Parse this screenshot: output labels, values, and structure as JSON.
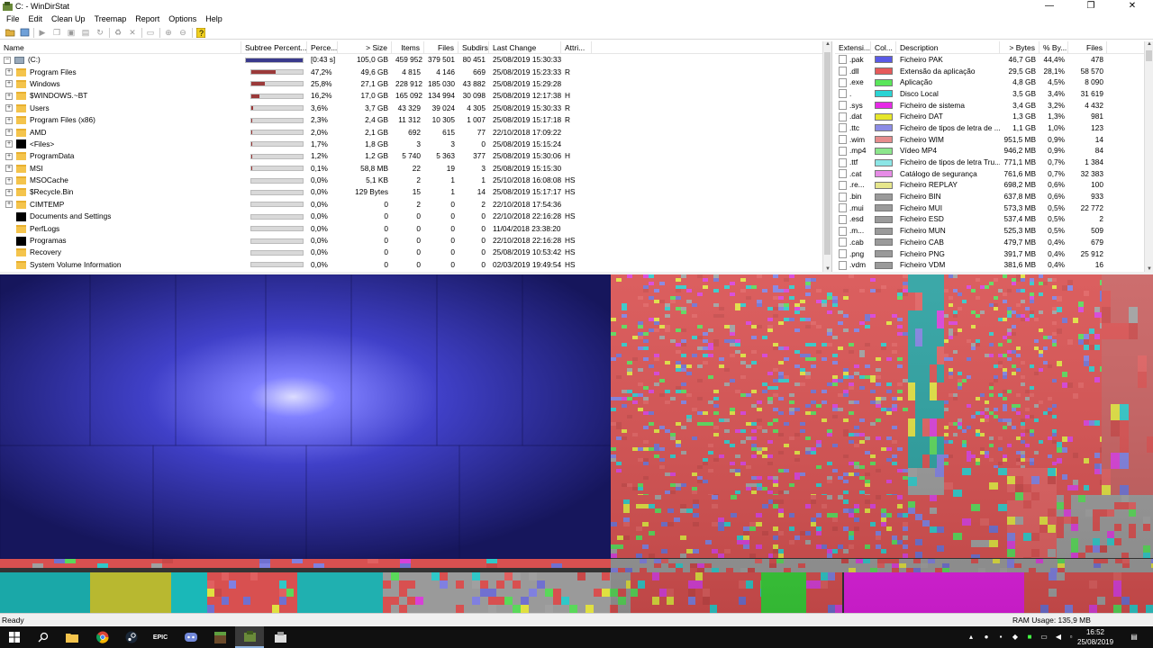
{
  "window": {
    "title": "C: - WinDirStat",
    "minimize": "—",
    "maximize": "❐",
    "close": "✕"
  },
  "menu": [
    "File",
    "Edit",
    "Clean Up",
    "Treemap",
    "Report",
    "Options",
    "Help"
  ],
  "toolbar": [
    "open-icon",
    "refresh-icon",
    "run-icon",
    "copy-path-icon",
    "explorer-icon",
    "command-prompt-icon",
    "refresh-selected-icon",
    "recycle-icon",
    "delete-icon",
    "new-folder-icon",
    "zoom-in-icon",
    "zoom-out-icon",
    "help-icon"
  ],
  "tree": {
    "headers": [
      "Name",
      "Subtree Percent...",
      "Perce...",
      "> Size",
      "Items",
      "Files",
      "Subdirs",
      "Last Change",
      "Attri..."
    ],
    "rows": [
      {
        "name": "(C:)",
        "icon": "drive",
        "expander": "-",
        "bar": 100,
        "top": true,
        "pct": "[0:43 s]",
        "size": "105,0 GB",
        "items": "459 952",
        "files": "379 501",
        "subdirs": "80 451",
        "change": "25/08/2019 15:30:33",
        "attr": ""
      },
      {
        "name": "Program Files",
        "icon": "folder",
        "expander": "+",
        "bar": 47.2,
        "pct": "47,2%",
        "size": "49,6 GB",
        "items": "4 815",
        "files": "4 146",
        "subdirs": "669",
        "change": "25/08/2019 15:23:33",
        "attr": "R"
      },
      {
        "name": "Windows",
        "icon": "folder",
        "expander": "+",
        "bar": 25.8,
        "pct": "25,8%",
        "size": "27,1 GB",
        "items": "228 912",
        "files": "185 030",
        "subdirs": "43 882",
        "change": "25/08/2019 15:29:28",
        "attr": ""
      },
      {
        "name": "$WINDOWS.~BT",
        "icon": "folder",
        "expander": "+",
        "bar": 16.2,
        "pct": "16,2%",
        "size": "17,0 GB",
        "items": "165 092",
        "files": "134 994",
        "subdirs": "30 098",
        "change": "25/08/2019 12:17:38",
        "attr": "H"
      },
      {
        "name": "Users",
        "icon": "folder",
        "expander": "+",
        "bar": 3.6,
        "pct": "3,6%",
        "size": "3,7 GB",
        "items": "43 329",
        "files": "39 024",
        "subdirs": "4 305",
        "change": "25/08/2019 15:30:33",
        "attr": "R"
      },
      {
        "name": "Program Files (x86)",
        "icon": "folder",
        "expander": "+",
        "bar": 2.3,
        "pct": "2,3%",
        "size": "2,4 GB",
        "items": "11 312",
        "files": "10 305",
        "subdirs": "1 007",
        "change": "25/08/2019 15:17:18",
        "attr": "R"
      },
      {
        "name": "AMD",
        "icon": "folder",
        "expander": "+",
        "bar": 2.0,
        "pct": "2,0%",
        "size": "2,1 GB",
        "items": "692",
        "files": "615",
        "subdirs": "77",
        "change": "22/10/2018 17:09:22",
        "attr": ""
      },
      {
        "name": "<Files>",
        "icon": "black",
        "expander": "+",
        "bar": 1.7,
        "pct": "1,7%",
        "size": "1,8 GB",
        "items": "3",
        "files": "3",
        "subdirs": "0",
        "change": "25/08/2019 15:15:24",
        "attr": ""
      },
      {
        "name": "ProgramData",
        "icon": "folder",
        "expander": "+",
        "bar": 1.2,
        "pct": "1,2%",
        "size": "1,2 GB",
        "items": "5 740",
        "files": "5 363",
        "subdirs": "377",
        "change": "25/08/2019 15:30:06",
        "attr": "H"
      },
      {
        "name": "MSI",
        "icon": "folder",
        "expander": "+",
        "bar": 0.1,
        "pct": "0,1%",
        "size": "58,8 MB",
        "items": "22",
        "files": "19",
        "subdirs": "3",
        "change": "25/08/2019 15:15:30",
        "attr": ""
      },
      {
        "name": "MSOCache",
        "icon": "folder",
        "expander": "+",
        "bar": 0,
        "pct": "0,0%",
        "size": "5,1 KB",
        "items": "2",
        "files": "1",
        "subdirs": "1",
        "change": "25/10/2018 16:08:08",
        "attr": "HS"
      },
      {
        "name": "$Recycle.Bin",
        "icon": "folder",
        "expander": "+",
        "bar": 0,
        "pct": "0,0%",
        "size": "129 Bytes",
        "items": "15",
        "files": "1",
        "subdirs": "14",
        "change": "25/08/2019 15:17:17",
        "attr": "HS"
      },
      {
        "name": "CIMTEMP",
        "icon": "folder",
        "expander": "+",
        "bar": 0,
        "pct": "0,0%",
        "size": "0",
        "items": "2",
        "files": "0",
        "subdirs": "2",
        "change": "22/10/2018 17:54:36",
        "attr": ""
      },
      {
        "name": "Documents and Settings",
        "icon": "black",
        "expander": "",
        "bar": 0,
        "pct": "0,0%",
        "size": "0",
        "items": "0",
        "files": "0",
        "subdirs": "0",
        "change": "22/10/2018 22:16:28",
        "attr": "HS"
      },
      {
        "name": "PerfLogs",
        "icon": "folder",
        "expander": "",
        "bar": 0,
        "pct": "0,0%",
        "size": "0",
        "items": "0",
        "files": "0",
        "subdirs": "0",
        "change": "11/04/2018 23:38:20",
        "attr": ""
      },
      {
        "name": "Programas",
        "icon": "black",
        "expander": "",
        "bar": 0,
        "pct": "0,0%",
        "size": "0",
        "items": "0",
        "files": "0",
        "subdirs": "0",
        "change": "22/10/2018 22:16:28",
        "attr": "HS"
      },
      {
        "name": "Recovery",
        "icon": "folder",
        "expander": "",
        "bar": 0,
        "pct": "0,0%",
        "size": "0",
        "items": "0",
        "files": "0",
        "subdirs": "0",
        "change": "25/08/2019 10:53:42",
        "attr": "HS"
      },
      {
        "name": "System Volume Information",
        "icon": "folder",
        "expander": "",
        "bar": 0,
        "pct": "0,0%",
        "size": "0",
        "items": "0",
        "files": "0",
        "subdirs": "0",
        "change": "02/03/2019 19:49:54",
        "attr": "HS"
      }
    ]
  },
  "extensions": {
    "headers": [
      "Extensi...",
      "Col...",
      "Description",
      "> Bytes",
      "% By...",
      "Files"
    ],
    "rows": [
      {
        "ext": ".pak",
        "color": "#5a5ae6",
        "desc": "Ficheiro PAK",
        "bytes": "46,7 GB",
        "pct": "44,4%",
        "files": "478"
      },
      {
        "ext": ".dll",
        "color": "#e65a5a",
        "desc": "Extensão da aplicação",
        "bytes": "29,5 GB",
        "pct": "28,1%",
        "files": "58 570"
      },
      {
        "ext": ".exe",
        "color": "#5ae65a",
        "desc": "Aplicação",
        "bytes": "4,8 GB",
        "pct": "4,5%",
        "files": "8 090"
      },
      {
        "ext": ".",
        "color": "#2ad4d4",
        "desc": "Disco Local",
        "bytes": "3,5 GB",
        "pct": "3,4%",
        "files": "31 619"
      },
      {
        "ext": ".sys",
        "color": "#e62ae6",
        "desc": "Ficheiro de sistema",
        "bytes": "3,4 GB",
        "pct": "3,2%",
        "files": "4 432"
      },
      {
        "ext": ".dat",
        "color": "#e6e62a",
        "desc": "Ficheiro DAT",
        "bytes": "1,3 GB",
        "pct": "1,3%",
        "files": "981"
      },
      {
        "ext": ".ttc",
        "color": "#8c8ce6",
        "desc": "Ficheiro de tipos de letra de ...",
        "bytes": "1,1 GB",
        "pct": "1,0%",
        "files": "123"
      },
      {
        "ext": ".wim",
        "color": "#e68c8c",
        "desc": "Ficheiro WIM",
        "bytes": "951,5 MB",
        "pct": "0,9%",
        "files": "14"
      },
      {
        "ext": ".mp4",
        "color": "#8ce68c",
        "desc": "Vídeo MP4",
        "bytes": "946,2 MB",
        "pct": "0,9%",
        "files": "84"
      },
      {
        "ext": ".ttf",
        "color": "#8ce6e6",
        "desc": "Ficheiro de tipos de letra Tru...",
        "bytes": "771,1 MB",
        "pct": "0,7%",
        "files": "1 384"
      },
      {
        "ext": ".cat",
        "color": "#e68ce6",
        "desc": "Catálogo de segurança",
        "bytes": "761,6 MB",
        "pct": "0,7%",
        "files": "32 383"
      },
      {
        "ext": ".re...",
        "color": "#e6e68c",
        "desc": "Ficheiro REPLAY",
        "bytes": "698,2 MB",
        "pct": "0,6%",
        "files": "100"
      },
      {
        "ext": ".bin",
        "color": "#9a9a9a",
        "desc": "Ficheiro BIN",
        "bytes": "637,8 MB",
        "pct": "0,6%",
        "files": "933"
      },
      {
        "ext": ".mui",
        "color": "#9a9a9a",
        "desc": "Ficheiro MUI",
        "bytes": "573,3 MB",
        "pct": "0,5%",
        "files": "22 772"
      },
      {
        "ext": ".esd",
        "color": "#9a9a9a",
        "desc": "Ficheiro ESD",
        "bytes": "537,4 MB",
        "pct": "0,5%",
        "files": "2"
      },
      {
        "ext": ".m...",
        "color": "#9a9a9a",
        "desc": "Ficheiro MUN",
        "bytes": "525,3 MB",
        "pct": "0,5%",
        "files": "509"
      },
      {
        "ext": ".cab",
        "color": "#9a9a9a",
        "desc": "Ficheiro CAB",
        "bytes": "479,7 MB",
        "pct": "0,4%",
        "files": "679"
      },
      {
        "ext": ".png",
        "color": "#9a9a9a",
        "desc": "Ficheiro PNG",
        "bytes": "391,7 MB",
        "pct": "0,4%",
        "files": "25 912"
      },
      {
        "ext": ".vdm",
        "color": "#9a9a9a",
        "desc": "Ficheiro VDM",
        "bytes": "381,6 MB",
        "pct": "0,4%",
        "files": "16"
      }
    ]
  },
  "status": {
    "text": "Ready",
    "ram": "RAM Usage:    135,9 MB"
  },
  "taskbar": {
    "apps": [
      "start-icon",
      "search-icon",
      "file-explorer-icon",
      "chrome-icon",
      "steam-icon",
      "epic-games-icon",
      "discord-icon",
      "minecraft-icon",
      "windirstat-icon",
      "app-icon"
    ],
    "epic_label": "EPIC",
    "time": "16:52",
    "date": "25/08/2019"
  }
}
